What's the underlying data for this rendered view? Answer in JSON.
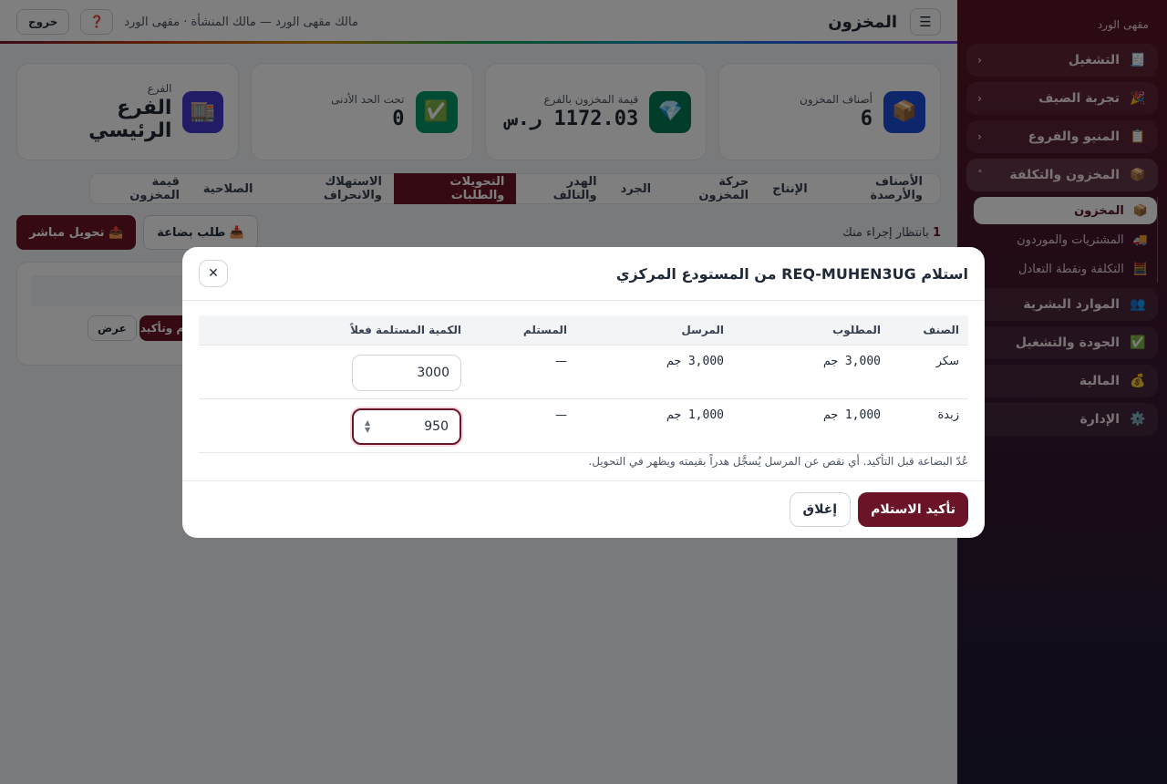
{
  "sidebar": {
    "brand": "مقهى الورد",
    "items": [
      {
        "label": "التشغيل",
        "icon": "🧾",
        "chevron": "‹"
      },
      {
        "label": "تجربة الضيف",
        "icon": "🎉",
        "chevron": "‹"
      },
      {
        "label": "المنيو والفروع",
        "icon": "📋",
        "chevron": "‹"
      },
      {
        "label": "المخزون والتكلفة",
        "icon": "📦",
        "chevron": "˄"
      }
    ],
    "subitems": [
      {
        "label": "المخزون",
        "icon": "📦"
      },
      {
        "label": "المشتريات والموردون",
        "icon": "🚚"
      },
      {
        "label": "التكلفة ونقطة التعادل",
        "icon": "🧮"
      }
    ],
    "items2": [
      {
        "label": "الموارد البشرية",
        "icon": "👥"
      },
      {
        "label": "الجودة والتشغيل",
        "icon": "✅"
      },
      {
        "label": "المالية",
        "icon": "💰"
      },
      {
        "label": "الإدارة",
        "icon": "⚙️"
      }
    ]
  },
  "topbar": {
    "menu_icon": "☰",
    "title": "المخزون",
    "owner": "مالك مقهى الورد — مالك المنشأة · مقهى الورد",
    "help": "❓",
    "logout": "خروج"
  },
  "stats": [
    {
      "label": "أصناف المخزون",
      "value": "6",
      "icon": "📦",
      "color": "#1d4ed8"
    },
    {
      "label": "قيمة المخزون بالفرع",
      "value": "1172.03 ر.س",
      "icon": "💎",
      "color": "#047857"
    },
    {
      "label": "تحت الحد الأدنى",
      "value": "0",
      "icon": "✅",
      "color": "#059669"
    },
    {
      "label": "الفرع",
      "value": "الفرع الرئيسي",
      "icon": "🏬",
      "color": "#4338ca"
    }
  ],
  "tabs": [
    "الأصناف والأرصدة",
    "الإنتاج",
    "حركة المخزون",
    "الجرد",
    "الهدر والتالف",
    "التحويلات والطلبات",
    "الاستهلاك والانحراف",
    "الصلاحية",
    "قيمة المخزون"
  ],
  "actions": {
    "pending_count": "1",
    "pending_text": " بانتظار إجراء منك",
    "request_goods": "📥 طلب بضاعة",
    "direct_transfer": "📤 تحويل مباشر"
  },
  "card": {
    "view": "عرض",
    "confirm_partial": "م وتأكيد"
  },
  "modal": {
    "title": "استلام REQ-MUHEN3UG من المستودع المركزي",
    "close_icon": "✕",
    "columns": [
      "الصنف",
      "المطلوب",
      "المرسل",
      "المستلم",
      "الكمية المستلمة فعلاً"
    ],
    "rows": [
      {
        "item": "سكر",
        "requested": "3,000 جم",
        "sent": "3,000 جم",
        "received": "—",
        "qty": "3000"
      },
      {
        "item": "زبدة",
        "requested": "1,000 جم",
        "sent": "1,000 جم",
        "received": "—",
        "qty": "950"
      }
    ],
    "hint": "عُدّ البضاعة قبل التأكيد. أي نقص عن المرسل يُسجَّل هدراً بقيمته ويظهر في التحويل.",
    "confirm": "تأكيد الاستلام",
    "close": "إغلاق"
  }
}
